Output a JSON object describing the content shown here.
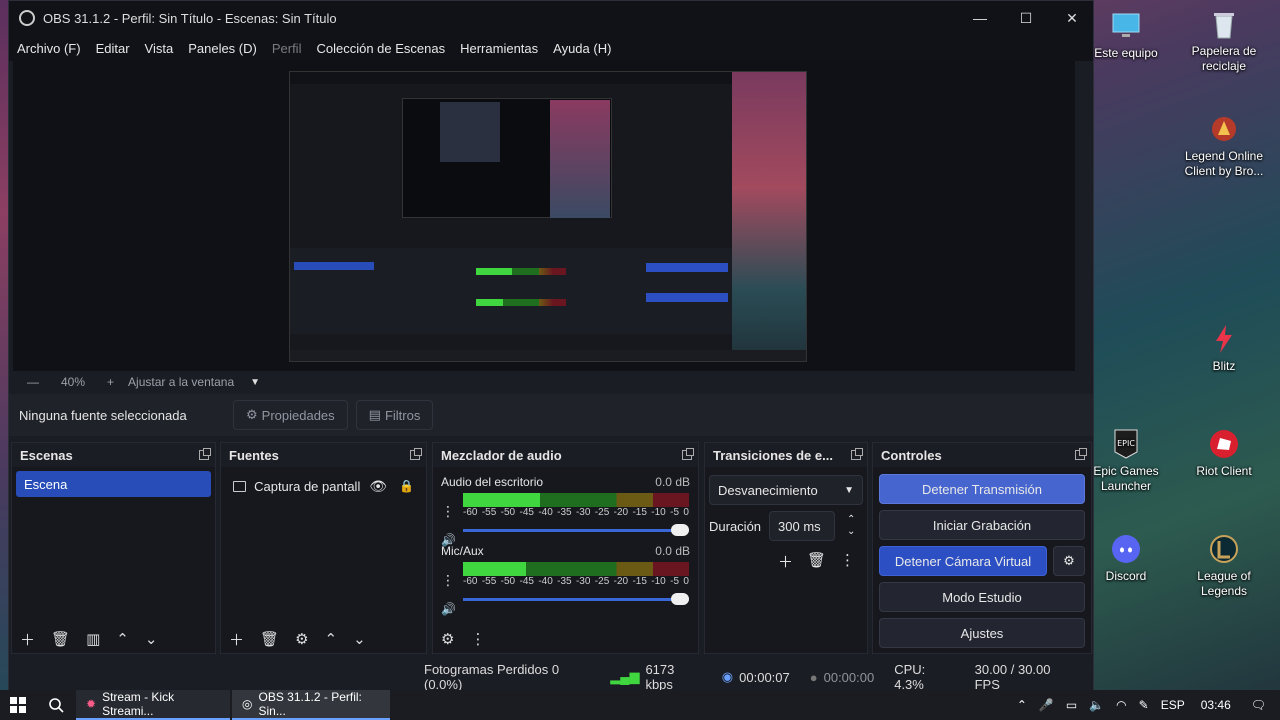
{
  "window": {
    "title": "OBS 31.1.2 - Perfil: Sin Título - Escenas: Sin Título",
    "minimize": "—",
    "maximize": "☐",
    "close": "✕"
  },
  "menu": [
    "Archivo (F)",
    "Editar",
    "Vista",
    "Paneles (D)",
    "Perfil",
    "Colección de Escenas",
    "Herramientas",
    "Ayuda (H)"
  ],
  "preview": {
    "zoom_minus": "—",
    "zoom": "40%",
    "zoom_plus": "+",
    "fit": "Ajustar a la ventana",
    "fit_arrow": "▼"
  },
  "source_bar": {
    "no_source": "Ninguna fuente seleccionada",
    "properties": "Propiedades",
    "filters": "Filtros"
  },
  "scenes": {
    "title": "Escenas",
    "items": [
      "Escena"
    ]
  },
  "sources": {
    "title": "Fuentes",
    "items": [
      "Captura de pantalla"
    ]
  },
  "mixer": {
    "title": "Mezclador de audio",
    "scale": [
      "-60",
      "-55",
      "-50",
      "-45",
      "-40",
      "-35",
      "-30",
      "-25",
      "-20",
      "-15",
      "-10",
      "-5",
      "0"
    ],
    "channels": [
      {
        "name": "Audio del escritorio",
        "db": "0.0 dB",
        "level": 0.34
      },
      {
        "name": "Mic/Aux",
        "db": "0.0 dB",
        "level": 0.28
      }
    ]
  },
  "transitions": {
    "title": "Transiciones de e...",
    "selected": "Desvanecimiento",
    "duration_label": "Duración",
    "duration_value": "300 ms"
  },
  "controls": {
    "title": "Controles",
    "stop_stream": "Detener Transmisión",
    "start_record": "Iniciar Grabación",
    "stop_vcam": "Detener Cámara Virtual",
    "studio_mode": "Modo Estudio",
    "settings": "Ajustes"
  },
  "status": {
    "dropped": "Fotogramas Perdidos 0 (0.0%)",
    "bitrate": "6173 kbps",
    "stream_time": "00:00:07",
    "rec_time": "00:00:00",
    "cpu": "CPU: 4.3%",
    "fps": "30.00 / 30.00 FPS"
  },
  "desktop_icons": [
    {
      "label": "Este equipo",
      "icon": "computer-icon"
    },
    {
      "label": "Papelera de reciclaje",
      "icon": "recycle-bin-icon"
    },
    {
      "label": "Legend Online Client by Bro...",
      "icon": "game-icon"
    },
    {
      "label": "Blitz",
      "icon": "blitz-icon"
    },
    {
      "label": "Epic Games Launcher",
      "icon": "epic-icon"
    },
    {
      "label": "Riot Client",
      "icon": "riot-icon"
    },
    {
      "label": "Discord",
      "icon": "discord-icon"
    },
    {
      "label": "League of Legends",
      "icon": "league-icon"
    }
  ],
  "taskbar": {
    "tasks": [
      "Stream - Kick Streami...",
      "OBS 31.1.2 - Perfil: Sin..."
    ],
    "lang": "ESP",
    "time": "03:46"
  },
  "colors": {
    "accent": "#2c4fc3",
    "meter_green": "#3fd63f",
    "window_bg": "#1b1d24"
  }
}
